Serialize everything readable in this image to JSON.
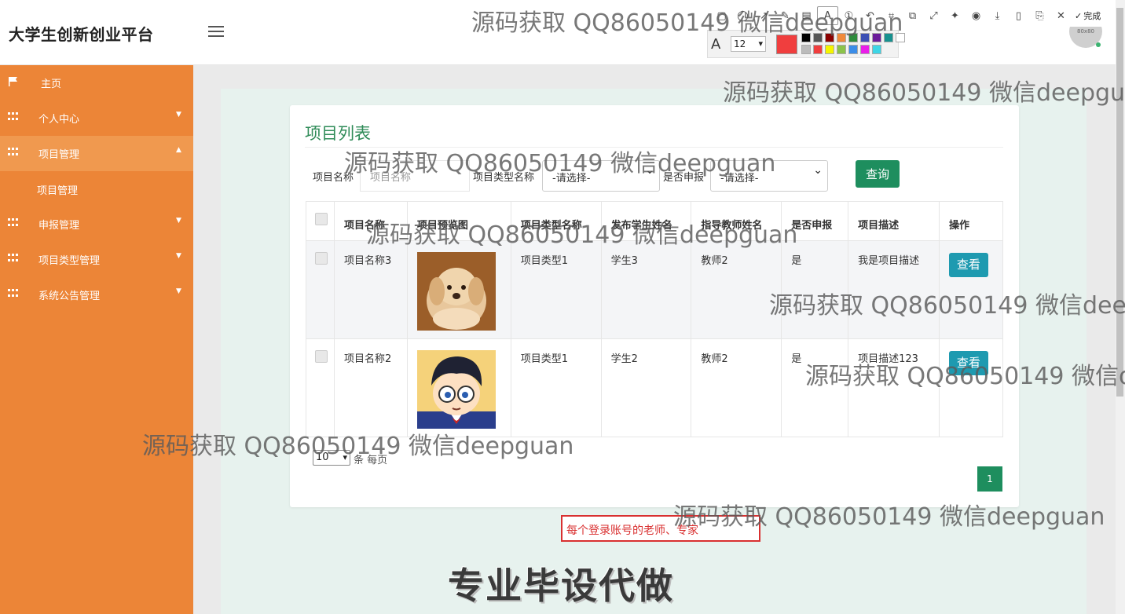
{
  "header": {
    "brand": "大学生创新创业平台",
    "avatar_text": "80x80"
  },
  "screenshot_tool": {
    "font_size": "12",
    "done_label": "完成",
    "current_color": "#f03e3e",
    "colors": [
      "#000000",
      "#555555",
      "#8b0000",
      "#f08a3c",
      "#2e8b3c",
      "#3c50b4",
      "#6a1b9a",
      "#17918f",
      "#ffffff",
      "#bbbbbb",
      "#f03e3e",
      "#f5f500",
      "#8bc34a",
      "#3b8de8",
      "#e91ee9",
      "#3ed6e6"
    ]
  },
  "sidebar": {
    "items": [
      {
        "label": "主页",
        "icon": "flag-icon"
      },
      {
        "label": "个人中心",
        "icon": "grid-icon"
      },
      {
        "label": "项目管理",
        "icon": "grid-icon"
      },
      {
        "label": "申报管理",
        "icon": "grid-icon"
      },
      {
        "label": "项目类型管理",
        "icon": "grid-icon"
      },
      {
        "label": "系统公告管理",
        "icon": "grid-icon"
      }
    ],
    "sub_item": "项目管理"
  },
  "panel": {
    "title": "项目列表",
    "filters": {
      "name_label": "项目名称",
      "name_placeholder": "项目名称",
      "type_label": "项目类型名称",
      "type_value": "-请选择-",
      "declare_label": "是否申报",
      "declare_value": "-请选择-",
      "query_label": "查询"
    },
    "table": {
      "headers": [
        "项目名称",
        "项目预览图",
        "项目类型名称",
        "发布学生姓名",
        "指导教师姓名",
        "是否申报",
        "项目描述",
        "操作"
      ],
      "rows": [
        {
          "name": "项目名称3",
          "image": "puppy-photo",
          "type": "项目类型1",
          "student": "学生3",
          "teacher": "教师2",
          "declared": "是",
          "desc": "我是项目描述",
          "action": "查看"
        },
        {
          "name": "项目名称2",
          "image": "anime-boy-photo",
          "type": "项目类型1",
          "student": "学生2",
          "teacher": "教师2",
          "declared": "是",
          "desc": "项目描述123",
          "action": "查看"
        }
      ]
    },
    "pager": {
      "page_size": "10",
      "per_page_text": "条 每页",
      "current_page": "1"
    }
  },
  "annotation_text": "每个登录账号的老师、专家",
  "promo_text": "专业毕设代做",
  "watermark": "源码获取 QQ86050149 微信deepguan"
}
